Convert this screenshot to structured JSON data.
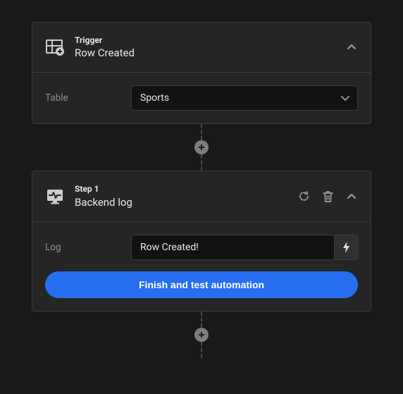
{
  "trigger": {
    "eyebrow": "Trigger",
    "title": "Row Created",
    "field_label": "Table",
    "field_value": "Sports"
  },
  "step1": {
    "eyebrow": "Step 1",
    "title": "Backend log",
    "field_label": "Log",
    "field_value": "Row Created!",
    "button_label": "Finish and test automation"
  }
}
